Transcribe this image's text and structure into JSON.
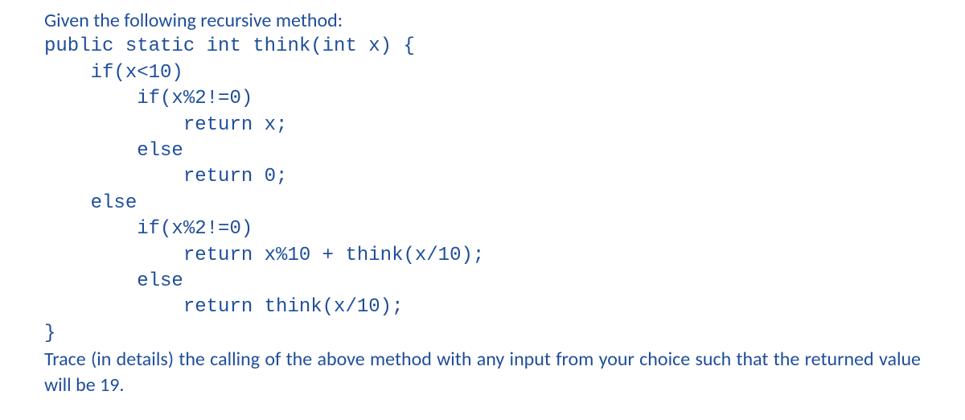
{
  "intro": "Given the following recursive method:",
  "code": {
    "l1": "public static int think(int x) {",
    "l2": "    if(x<10)",
    "l3": "        if(x%2!=0)",
    "l4": "            return x;",
    "l5": "        else",
    "l6": "            return 0;",
    "l7": "    else",
    "l8": "        if(x%2!=0)",
    "l9": "            return x%10 + think(x/10);",
    "l10": "        else",
    "l11": "            return think(x/10);",
    "l12": "}"
  },
  "trace_prompt": "Trace (in details) the calling of the above method with any input from your choice such that the returned value will be 19."
}
